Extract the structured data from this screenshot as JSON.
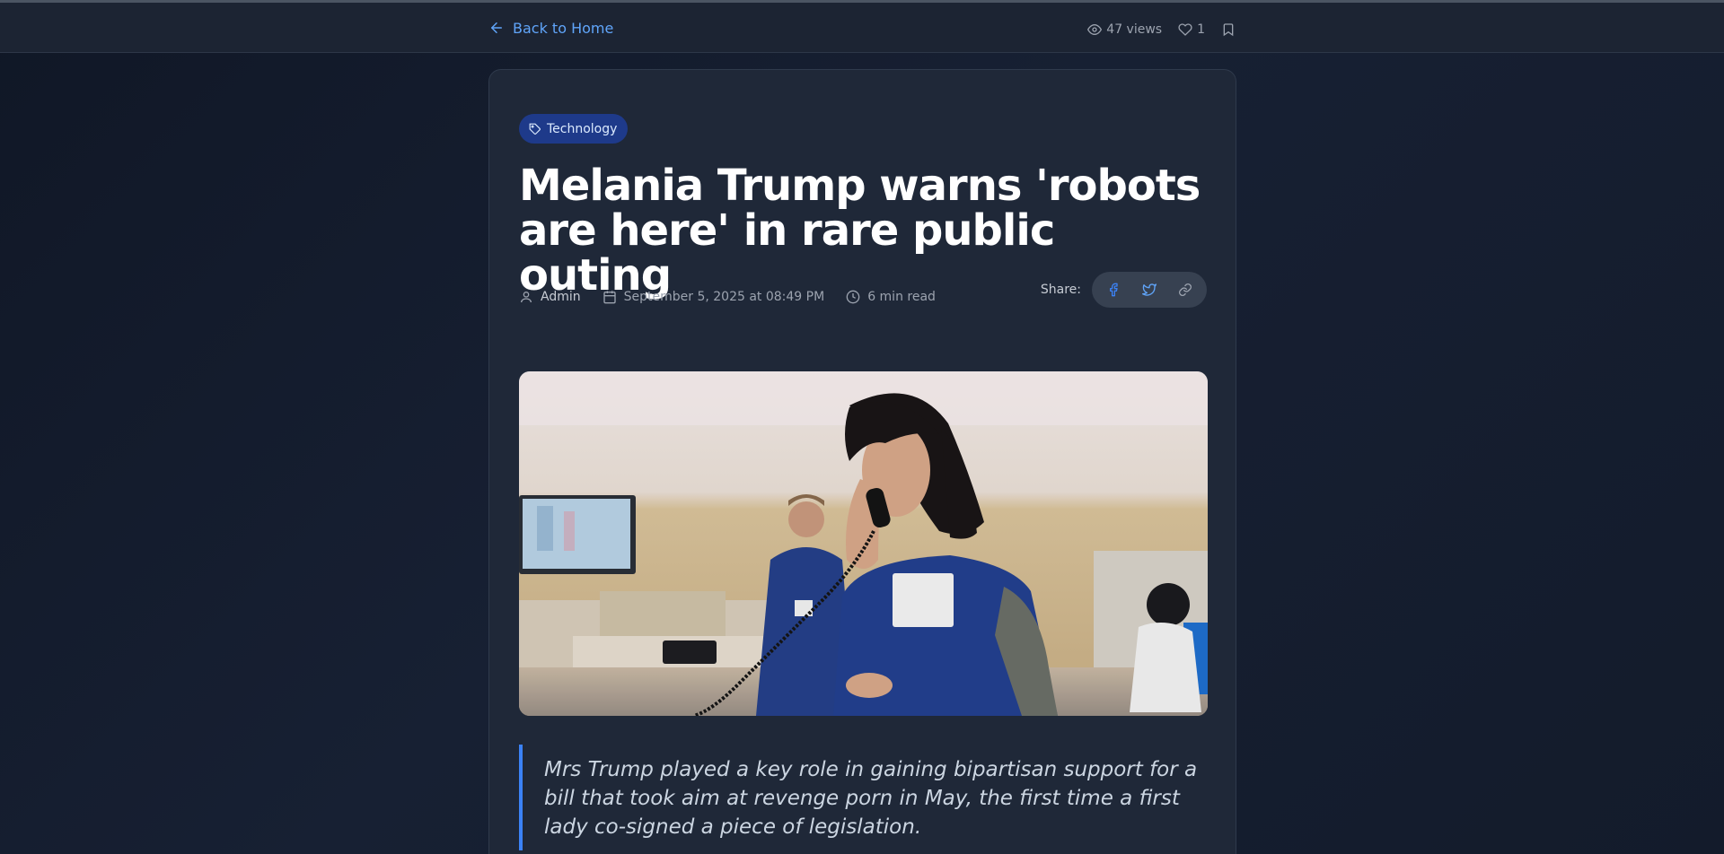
{
  "header": {
    "back_label": "Back to Home",
    "views": "47 views",
    "likes": "1"
  },
  "article": {
    "category": "Technology",
    "title": "Melania Trump warns 'robots are here' in rare public outing",
    "author": "Admin",
    "date": "September 5, 2025 at 08:49 PM",
    "read_time": "6 min read",
    "share_label": "Share:",
    "quote": "Mrs Trump played a key role in gaining bipartisan support for a bill that took aim at revenge porn in May, the first time a first lady co-signed a piece of legislation."
  },
  "colors": {
    "accent": "#60a5fa",
    "tag_bg": "#1e3a8a",
    "quote_border": "#3b82f6"
  }
}
